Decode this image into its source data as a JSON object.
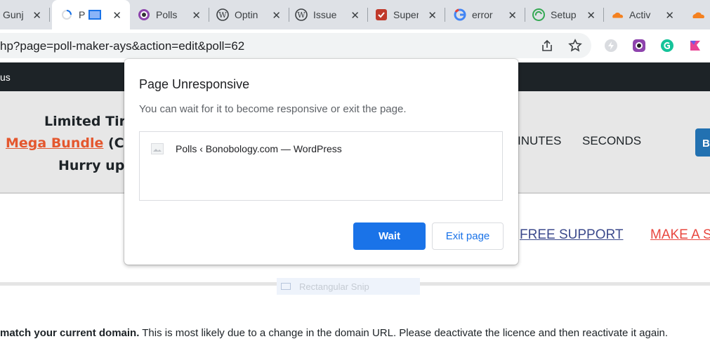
{
  "tabs": [
    {
      "title": "Gunj",
      "icon": "generic-site-icon",
      "active": false
    },
    {
      "title": "P",
      "icon": "loading-spinner-icon",
      "active": true
    },
    {
      "title": "Polls",
      "icon": "ays-polls-icon",
      "active": false
    },
    {
      "title": "Optin",
      "icon": "wordpress-icon",
      "active": false
    },
    {
      "title": "Issue",
      "icon": "wordpress-icon",
      "active": false
    },
    {
      "title": "Super",
      "icon": "super-icon",
      "active": false
    },
    {
      "title": "error",
      "icon": "google-icon",
      "active": false
    },
    {
      "title": "Setup",
      "icon": "setup-icon",
      "active": false
    },
    {
      "title": "Activ",
      "icon": "cloudflare-icon",
      "active": false
    }
  ],
  "omnibox": {
    "url": "hp?page=poll-maker-ays&action=edit&poll=62"
  },
  "admin_bar": {
    "text": "us"
  },
  "banner": {
    "line1": "Limited Tir",
    "bundle_link": "Mega Bundle",
    "line2_suffix": " (C",
    "line3": "Hurry up",
    "minutes_label": "INUTES",
    "seconds_label": "SECONDS",
    "button_label": "B"
  },
  "nav": {
    "free_support": "FREE SUPPORT",
    "make_a": "MAKE A S"
  },
  "snip_label": "Rectangular Snip",
  "notice": {
    "bold": "match your current domain.",
    "rest": " This is most likely due to a change in the domain URL. Please deactivate the licence and then reactivate it again."
  },
  "dialog": {
    "title": "Page Unresponsive",
    "message": "You can wait for it to become responsive or exit the page.",
    "page_item": "Polls ‹ Bonobology.com — WordPress",
    "wait_label": "Wait",
    "exit_label": "Exit page"
  },
  "colors": {
    "accent": "#1a73e8",
    "admin_bar": "#1d2327",
    "link_orange": "#e4572e",
    "link_blue": "#3c4a8c",
    "link_red": "#e8473f"
  }
}
